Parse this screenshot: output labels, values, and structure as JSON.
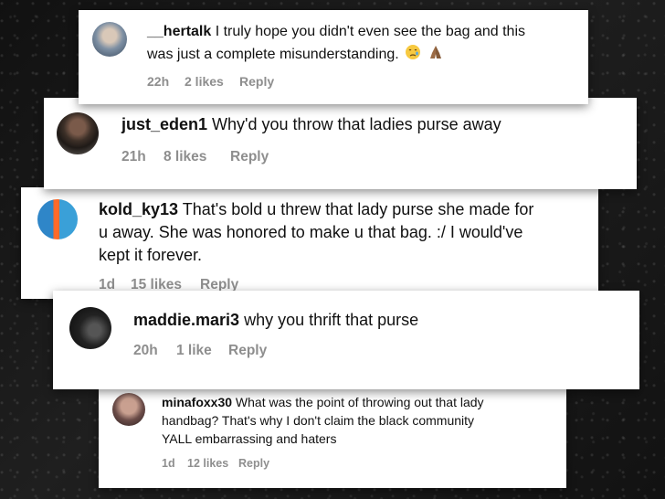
{
  "comments": [
    {
      "username": "__hertalk",
      "lines": [
        " I truly hope you didn't even see the bag and this",
        "was just a complete misunderstanding."
      ],
      "emoji": [
        "crying-face-icon",
        "praying-hands-icon"
      ],
      "time": "22h",
      "likes": "2 likes",
      "reply": "Reply"
    },
    {
      "username": "just_eden1",
      "lines": [
        " Why'd you throw that ladies purse away"
      ],
      "time": "21h",
      "likes": "8 likes",
      "reply": "Reply"
    },
    {
      "username": "kold_ky13",
      "lines": [
        " That's bold u threw that lady purse she made for",
        "u away. She was honored to make u that bag. :/ I would've",
        "kept it forever."
      ],
      "time": "1d",
      "likes": "15 likes",
      "reply": "Reply"
    },
    {
      "username": "maddie.mari3",
      "lines": [
        " why you thrift that purse"
      ],
      "time": "20h",
      "likes": "1 like",
      "reply": "Reply"
    },
    {
      "username": "minafoxx30",
      "lines": [
        " What was the point of throwing out that lady",
        "handbag? That's why I don't claim the black community",
        "YALL embarrassing and haters"
      ],
      "time": "1d",
      "likes": "12 likes",
      "reply": "Reply"
    }
  ]
}
